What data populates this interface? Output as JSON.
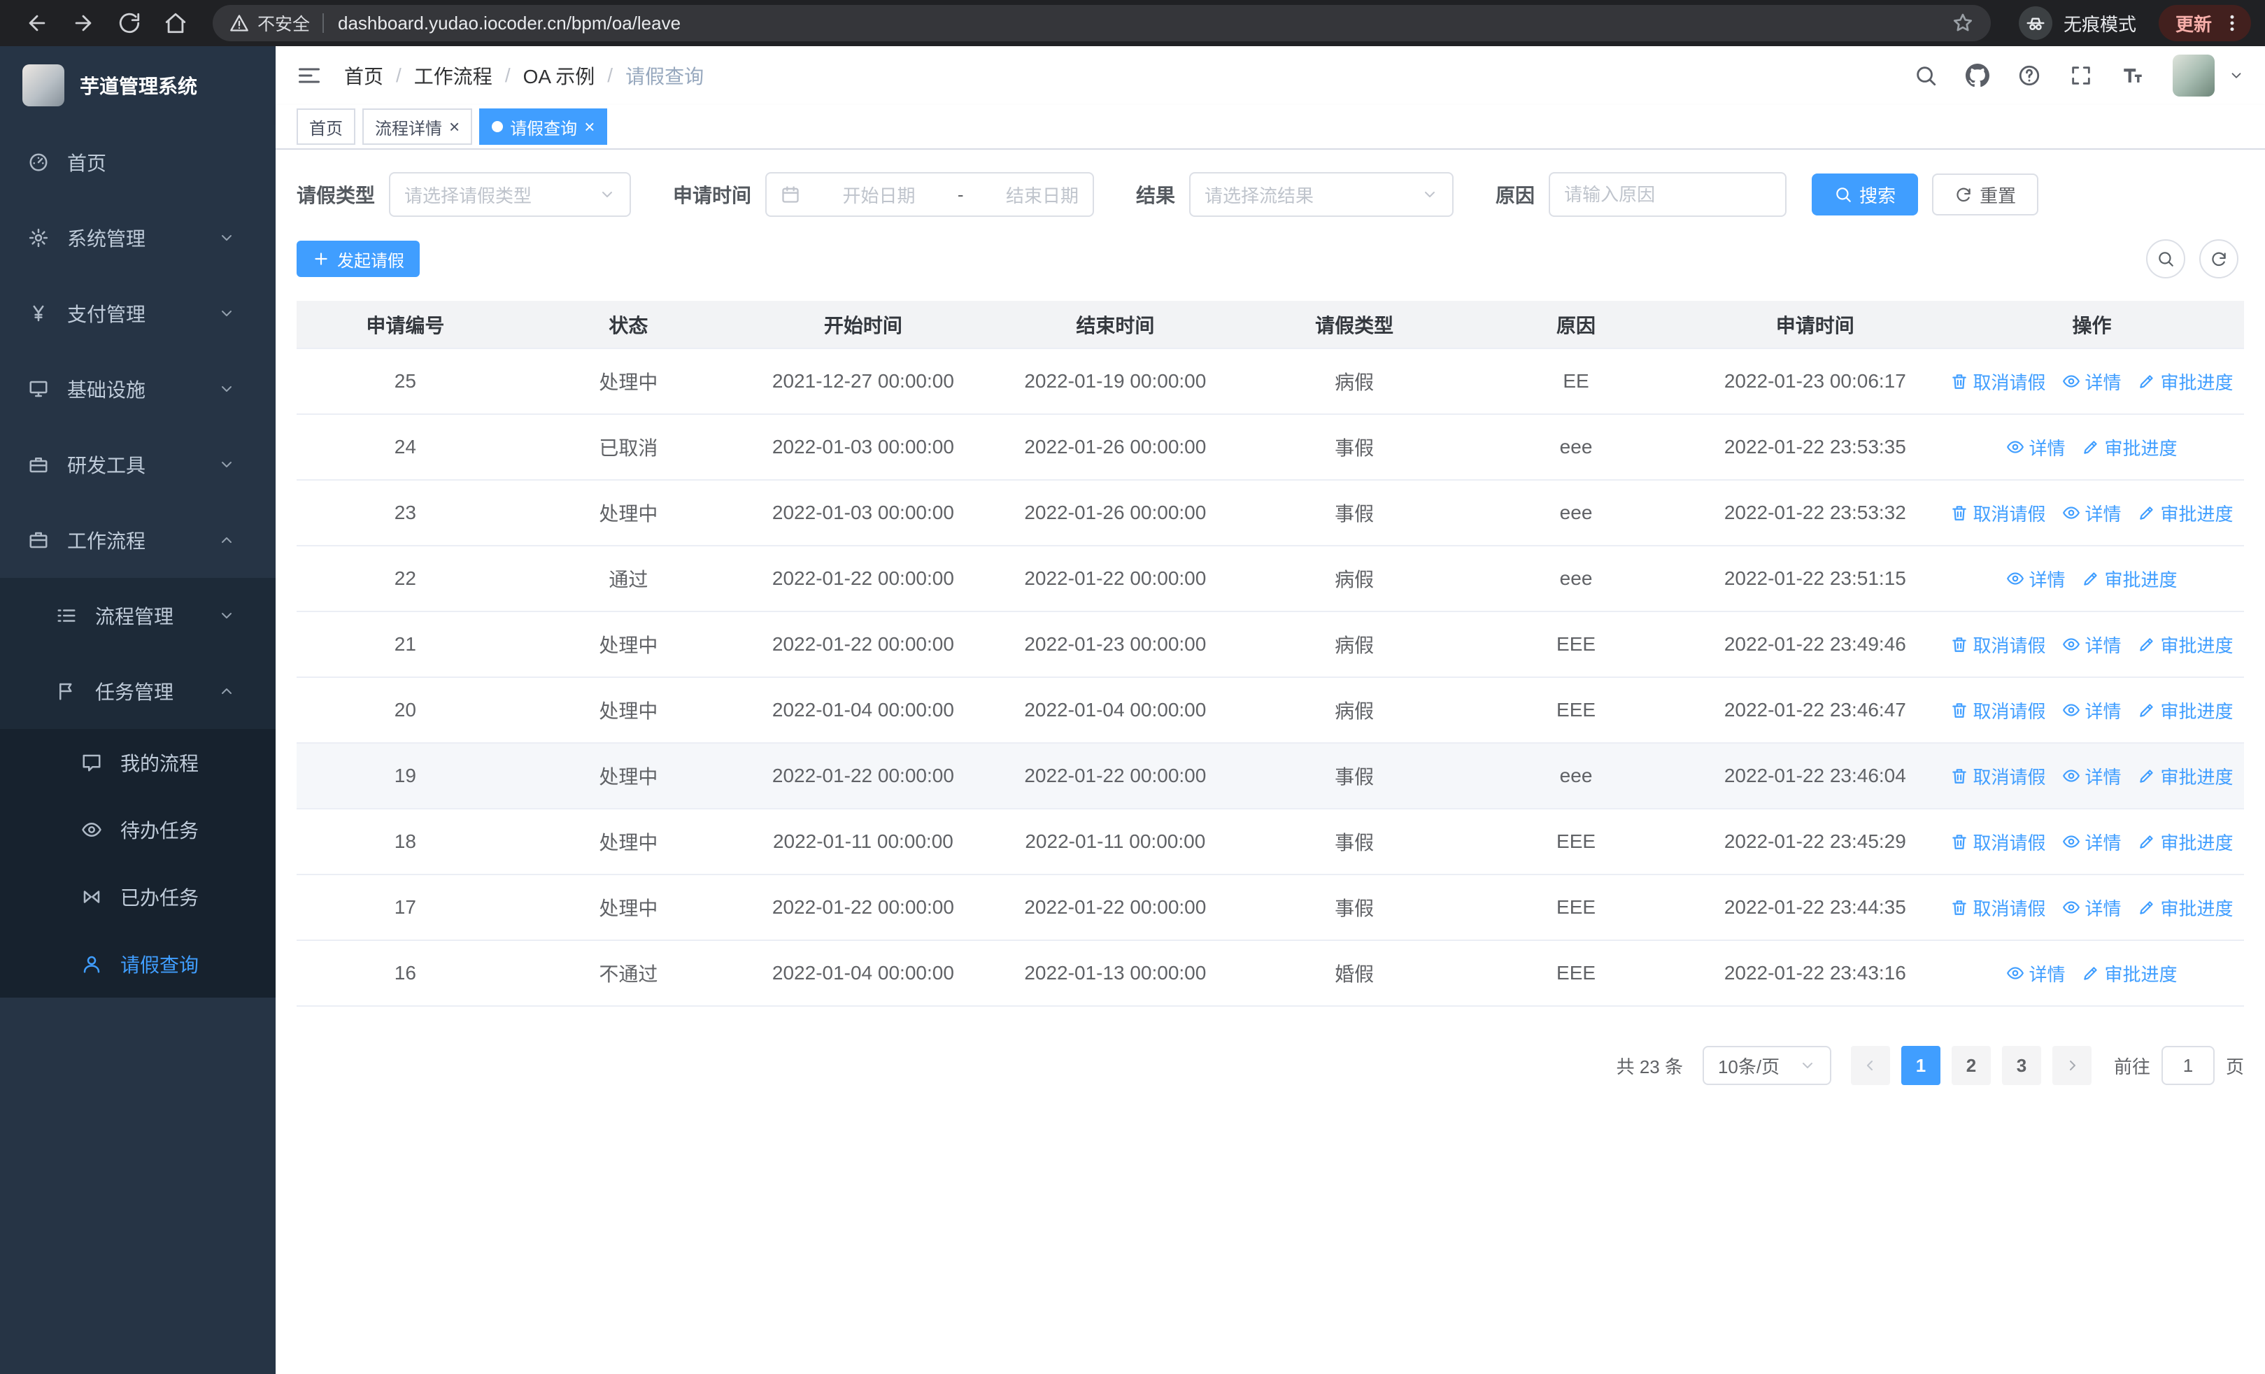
{
  "browser": {
    "security_label": "不安全",
    "url": "dashboard.yudao.iocoder.cn/bpm/oa/leave",
    "incognito_label": "无痕模式",
    "update_label": "更新"
  },
  "sidebar": {
    "logo_title": "芋道管理系统",
    "items": [
      {
        "key": "home",
        "label": "首页",
        "icon": "dashboard-icon",
        "level": 0
      },
      {
        "key": "system-management",
        "label": "系统管理",
        "icon": "gear-icon",
        "level": 0,
        "chevron": "down"
      },
      {
        "key": "payment-management",
        "label": "支付管理",
        "icon": "yen-icon",
        "level": 0,
        "chevron": "down"
      },
      {
        "key": "infrastructure",
        "label": "基础设施",
        "icon": "monitor-icon",
        "level": 0,
        "chevron": "down"
      },
      {
        "key": "dev-tools",
        "label": "研发工具",
        "icon": "toolbox-icon",
        "level": 0,
        "chevron": "down"
      },
      {
        "key": "workflow",
        "label": "工作流程",
        "icon": "briefcase-icon",
        "level": 0,
        "chevron": "up"
      },
      {
        "key": "process-management",
        "label": "流程管理",
        "icon": "list-icon",
        "level": 1,
        "chevron": "down"
      },
      {
        "key": "task-management",
        "label": "任务管理",
        "icon": "flag-icon",
        "level": 1,
        "chevron": "up"
      },
      {
        "key": "my-process",
        "label": "我的流程",
        "icon": "chat-icon",
        "level": 2
      },
      {
        "key": "todo-tasks",
        "label": "待办任务",
        "icon": "eye-icon",
        "level": 2
      },
      {
        "key": "done-tasks",
        "label": "已办任务",
        "icon": "bowtie-icon",
        "level": 2
      },
      {
        "key": "leave-query",
        "label": "请假查询",
        "icon": "user-icon",
        "level": 2,
        "active": true
      }
    ]
  },
  "navbar": {
    "breadcrumb": [
      "首页",
      "工作流程",
      "OA 示例",
      "请假查询"
    ]
  },
  "tabs": [
    {
      "key": "home",
      "label": "首页",
      "active": false,
      "closable": false
    },
    {
      "key": "process-detail",
      "label": "流程详情",
      "active": false,
      "closable": true
    },
    {
      "key": "leave-query",
      "label": "请假查询",
      "active": true,
      "closable": true
    }
  ],
  "filters": {
    "leave_type_label": "请假类型",
    "leave_type_placeholder": "请选择请假类型",
    "apply_time_label": "申请时间",
    "start_date_placeholder": "开始日期",
    "range_separator": "-",
    "end_date_placeholder": "结束日期",
    "result_label": "结果",
    "result_placeholder": "请选择流结果",
    "reason_label": "原因",
    "reason_placeholder": "请输入原因",
    "search_label": "搜索",
    "reset_label": "重置"
  },
  "toolbar": {
    "create_label": "发起请假"
  },
  "table": {
    "columns": [
      "申请编号",
      "状态",
      "开始时间",
      "结束时间",
      "请假类型",
      "原因",
      "申请时间",
      "操作"
    ],
    "action_labels": {
      "cancel": "取消请假",
      "detail": "详情",
      "progress": "审批进度"
    },
    "rows": [
      {
        "id": "25",
        "status": "处理中",
        "start_time": "2021-12-27 00:00:00",
        "end_time": "2022-01-19 00:00:00",
        "leave_type": "病假",
        "reason": "EE",
        "apply_time": "2022-01-23 00:06:17",
        "actions": [
          "cancel",
          "detail",
          "progress"
        ],
        "highlight": false
      },
      {
        "id": "24",
        "status": "已取消",
        "start_time": "2022-01-03 00:00:00",
        "end_time": "2022-01-26 00:00:00",
        "leave_type": "事假",
        "reason": "eee",
        "apply_time": "2022-01-22 23:53:35",
        "actions": [
          "detail",
          "progress"
        ],
        "highlight": false
      },
      {
        "id": "23",
        "status": "处理中",
        "start_time": "2022-01-03 00:00:00",
        "end_time": "2022-01-26 00:00:00",
        "leave_type": "事假",
        "reason": "eee",
        "apply_time": "2022-01-22 23:53:32",
        "actions": [
          "cancel",
          "detail",
          "progress"
        ],
        "highlight": false
      },
      {
        "id": "22",
        "status": "通过",
        "start_time": "2022-01-22 00:00:00",
        "end_time": "2022-01-22 00:00:00",
        "leave_type": "病假",
        "reason": "eee",
        "apply_time": "2022-01-22 23:51:15",
        "actions": [
          "detail",
          "progress"
        ],
        "highlight": false
      },
      {
        "id": "21",
        "status": "处理中",
        "start_time": "2022-01-22 00:00:00",
        "end_time": "2022-01-23 00:00:00",
        "leave_type": "病假",
        "reason": "EEE",
        "apply_time": "2022-01-22 23:49:46",
        "actions": [
          "cancel",
          "detail",
          "progress"
        ],
        "highlight": false
      },
      {
        "id": "20",
        "status": "处理中",
        "start_time": "2022-01-04 00:00:00",
        "end_time": "2022-01-04 00:00:00",
        "leave_type": "病假",
        "reason": "EEE",
        "apply_time": "2022-01-22 23:46:47",
        "actions": [
          "cancel",
          "detail",
          "progress"
        ],
        "highlight": false
      },
      {
        "id": "19",
        "status": "处理中",
        "start_time": "2022-01-22 00:00:00",
        "end_time": "2022-01-22 00:00:00",
        "leave_type": "事假",
        "reason": "eee",
        "apply_time": "2022-01-22 23:46:04",
        "actions": [
          "cancel",
          "detail",
          "progress"
        ],
        "highlight": true
      },
      {
        "id": "18",
        "status": "处理中",
        "start_time": "2022-01-11 00:00:00",
        "end_time": "2022-01-11 00:00:00",
        "leave_type": "事假",
        "reason": "EEE",
        "apply_time": "2022-01-22 23:45:29",
        "actions": [
          "cancel",
          "detail",
          "progress"
        ],
        "highlight": false
      },
      {
        "id": "17",
        "status": "处理中",
        "start_time": "2022-01-22 00:00:00",
        "end_time": "2022-01-22 00:00:00",
        "leave_type": "事假",
        "reason": "EEE",
        "apply_time": "2022-01-22 23:44:35",
        "actions": [
          "cancel",
          "detail",
          "progress"
        ],
        "highlight": false
      },
      {
        "id": "16",
        "status": "不通过",
        "start_time": "2022-01-04 00:00:00",
        "end_time": "2022-01-13 00:00:00",
        "leave_type": "婚假",
        "reason": "EEE",
        "apply_time": "2022-01-22 23:43:16",
        "actions": [
          "detail",
          "progress"
        ],
        "highlight": false
      }
    ]
  },
  "pagination": {
    "total_label": "共 23 条",
    "page_size": "10条/页",
    "pages": [
      "1",
      "2",
      "3"
    ],
    "active_page": "1",
    "goto_label": "前往",
    "goto_value": "1",
    "page_suffix": "页"
  }
}
